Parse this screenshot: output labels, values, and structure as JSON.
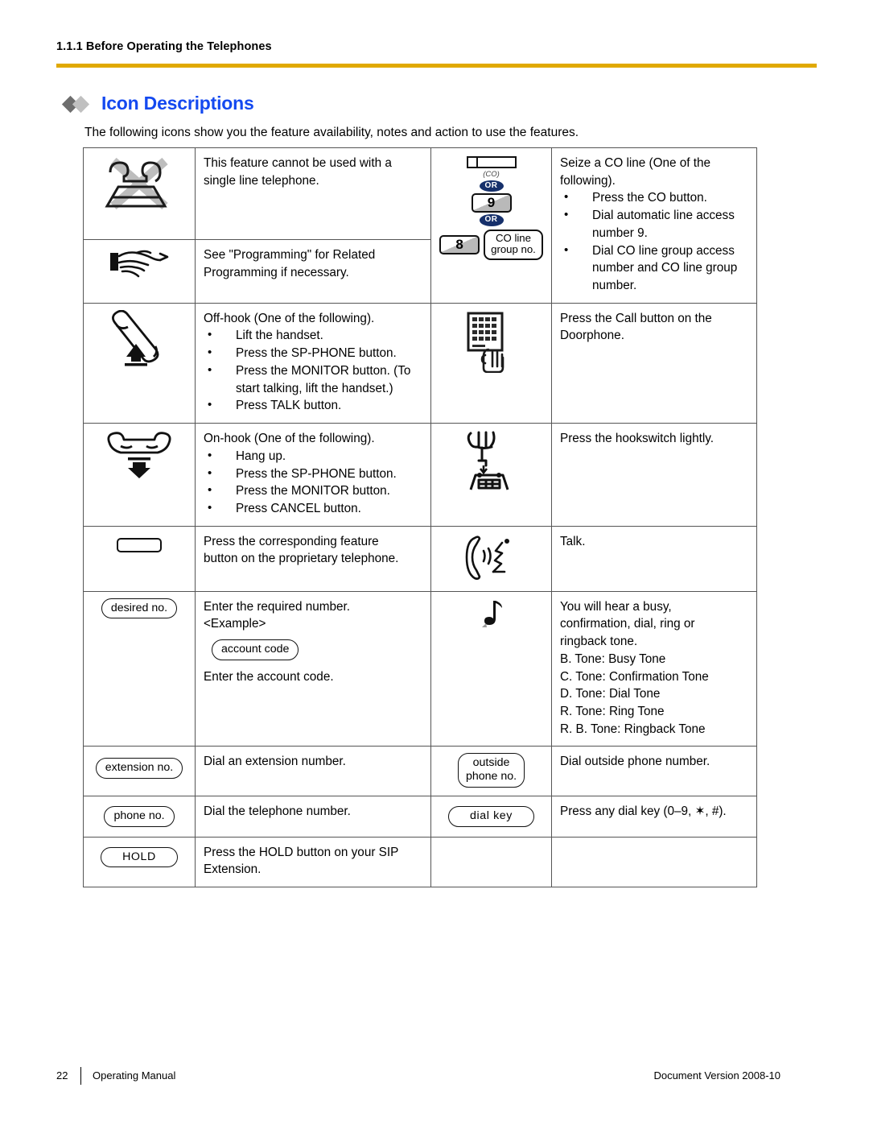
{
  "header": {
    "breadcrumb": "1.1.1 Before Operating the Telephones",
    "rule_color": "#e0a900"
  },
  "section": {
    "title": "Icon Descriptions",
    "title_color": "#1449f0",
    "intro": "The following icons show you the feature availability, notes and action to use the features."
  },
  "table": {
    "rows": [
      {
        "left_icon": "crossed-telephone-icon",
        "left_desc": [
          "This feature cannot be used with a",
          "single line telephone."
        ],
        "right_icon": "co-line-button-icon",
        "right_desc_lead": [
          "Seize a CO line (One of the",
          "following)."
        ],
        "right_bullets": [
          "Press the CO button.",
          "Dial automatic line access number 9.",
          "Dial CO line group access number and CO line group number."
        ]
      },
      {
        "left_icon": "pointing-hand-icon",
        "left_desc": [
          "See \"Programming\" for Related",
          "Programming if necessary."
        ]
      },
      {
        "left_icon": "off-hook-handset-icon",
        "left_desc_lead": "Off-hook (One of the following).",
        "left_bullets": [
          "Lift the handset.",
          "Press the SP-PHONE button.",
          "Press the MONITOR button. (To start talking, lift the handset.)",
          "Press TALK button."
        ],
        "right_icon": "doorphone-keypad-finger-icon",
        "right_desc": [
          "Press the Call button on the",
          "Doorphone."
        ]
      },
      {
        "left_icon": "on-hook-handset-icon",
        "left_desc_lead": "On-hook (One of the following).",
        "left_bullets": [
          "Hang up.",
          "Press the SP-PHONE button.",
          "Press the MONITOR button.",
          "Press CANCEL button."
        ],
        "right_icon": "hookswitch-icon",
        "right_desc": [
          "Press the hookswitch lightly."
        ]
      },
      {
        "left_icon": "feature-button-icon",
        "left_desc": [
          "Press the corresponding feature",
          "button on the proprietary telephone."
        ],
        "right_icon": "talking-handset-icon",
        "right_desc": [
          "Talk."
        ]
      },
      {
        "left_icon": "desired-no-key-icon",
        "left_icon_label": "desired no.",
        "left_desc_lead_1": "Enter the required number.",
        "left_desc_lead_2": "<Example>",
        "left_inline_key": "account code",
        "left_desc_tail": "Enter the account code.",
        "right_icon": "tone-note-icon",
        "right_desc": [
          "You will hear a busy,",
          "confirmation, dial, ring or",
          "ringback tone.",
          "B. Tone: Busy Tone",
          "C. Tone: Confirmation Tone",
          "D. Tone: Dial Tone",
          "R. Tone: Ring Tone",
          "R. B. Tone: Ringback Tone"
        ]
      },
      {
        "left_icon": "extension-no-key-icon",
        "left_icon_label": "extension no.",
        "left_desc": [
          "Dial an extension number."
        ],
        "right_icon": "outside-phone-no-key-icon",
        "right_icon_label_1": "outside",
        "right_icon_label_2": "phone no.",
        "right_desc": [
          "Dial outside phone number."
        ]
      },
      {
        "left_icon": "phone-no-key-icon",
        "left_icon_label": "phone no.",
        "left_desc": [
          "Dial the telephone number."
        ],
        "right_icon": "dial-key-icon",
        "right_icon_label": "dial key",
        "right_desc": [
          "Press any dial key (0–9, ✶, #)."
        ]
      },
      {
        "left_icon": "hold-key-icon",
        "left_icon_label": "HOLD",
        "left_desc": [
          "Press the HOLD button on your SIP",
          "Extension."
        ],
        "right_icon": "",
        "right_desc": [
          ""
        ]
      }
    ],
    "co_icon": {
      "co_caption": "(CO)",
      "or_1": "OR",
      "key_9": "9",
      "or_2": "OR",
      "key_8": "8",
      "group_line_1": "CO line",
      "group_line_2": "group no."
    }
  },
  "footer": {
    "page_number": "22",
    "manual_label": "Operating Manual",
    "document_version": "Document Version  2008-10"
  }
}
